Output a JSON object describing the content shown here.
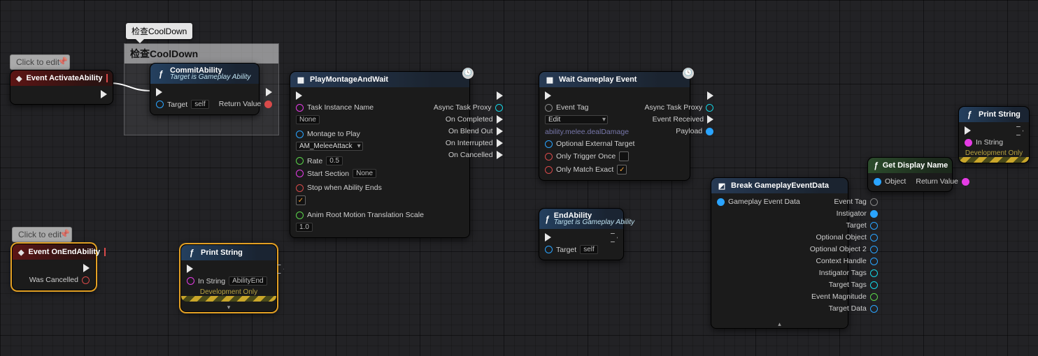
{
  "comments": {
    "cooldown_bubble": "检查CoolDown",
    "cooldown_box_title": "检查CoolDown",
    "click_edit_top": "Click to edit",
    "click_edit_bottom": "Click to edit"
  },
  "nodes": {
    "activateAbility": {
      "title": "Event ActivateAbility"
    },
    "commitAbility": {
      "title": "CommitAbility",
      "subtitle": "Target is Gameplay Ability",
      "target": "Target",
      "targetVal": "self",
      "returnVal": "Return Value"
    },
    "playMontage": {
      "title": "PlayMontageAndWait",
      "taskInstanceName": "Task Instance Name",
      "taskInstanceVal": "None",
      "montageToPlay": "Montage to Play",
      "montageVal": "AM_MeleeAttack",
      "rate": "Rate",
      "rateVal": "0.5",
      "startSection": "Start Section",
      "startSectionVal": "None",
      "stopOnEnd": "Stop when Ability Ends",
      "animRoot": "Anim Root Motion Translation Scale",
      "animRootVal": "1.0",
      "asyncProxy": "Async Task Proxy",
      "onCompleted": "On Completed",
      "onBlendOut": "On Blend Out",
      "onInterrupted": "On Interrupted",
      "onCancelled": "On Cancelled"
    },
    "waitEvent": {
      "title": "Wait Gameplay Event",
      "eventTag": "Event Tag",
      "eventTagVal": "Edit",
      "eventTagPath": "ability.melee.dealDamage",
      "optionalExternal": "Optional External Target",
      "triggerOnce": "Only Trigger Once",
      "matchExact": "Only Match Exact",
      "asyncProxy": "Async Task Proxy",
      "eventReceived": "Event Received",
      "payload": "Payload"
    },
    "endAbility": {
      "title": "EndAbility",
      "subtitle": "Target is Gameplay Ability",
      "target": "Target",
      "targetVal": "self"
    },
    "onEndAbility": {
      "title": "Event OnEndAbility",
      "wasCancelled": "Was Cancelled"
    },
    "printString1": {
      "title": "Print String",
      "inString": "In String",
      "inStringVal": "AbilityEnd",
      "dev": "Development Only"
    },
    "breakEvent": {
      "title": "Break GameplayEventData",
      "gameplayEventData": "Gameplay Event Data",
      "eventTag": "Event Tag",
      "instigator": "Instigator",
      "target": "Target",
      "optionalObject": "Optional Object",
      "optionalObject2": "Optional Object 2",
      "contextHandle": "Context Handle",
      "instigatorTags": "Instigator Tags",
      "targetTags": "Target Tags",
      "eventMagnitude": "Event Magnitude",
      "targetData": "Target Data"
    },
    "getDisplayName": {
      "title": "Get Display Name",
      "object": "Object",
      "returnVal": "Return Value"
    },
    "printString2": {
      "title": "Print String",
      "inString": "In String",
      "dev": "Development Only"
    }
  }
}
